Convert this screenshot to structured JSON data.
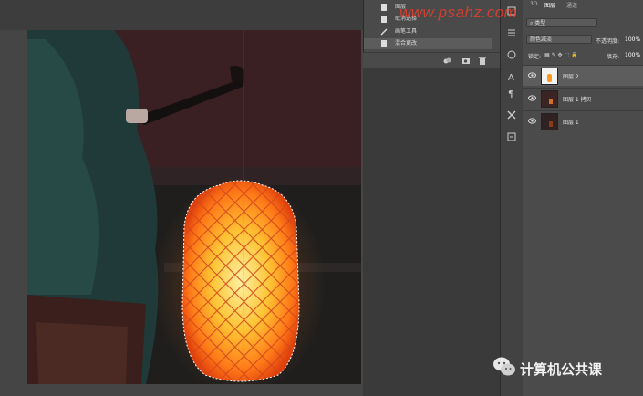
{
  "watermark": "www.psahz.com",
  "history": {
    "items": [
      {
        "label": "图层"
      },
      {
        "label": "取消选择"
      },
      {
        "label": "画笔工具"
      },
      {
        "label": "混合更改"
      }
    ]
  },
  "layers_panel": {
    "tabs": [
      "3D",
      "图层",
      "通道"
    ],
    "search_placeholder": "类型",
    "blend_mode": "颜色减淡",
    "opacity_label": "不透明度:",
    "opacity_value": "100%",
    "lock_label": "锁定:",
    "fill_label": "填充:",
    "fill_value": "100%",
    "layers": [
      {
        "name": "图层 2",
        "visible": true,
        "active": true
      },
      {
        "name": "图层 1 拷贝",
        "visible": true,
        "active": false
      },
      {
        "name": "图层 1",
        "visible": true,
        "active": false
      }
    ]
  },
  "footer": {
    "brand": "计算机公共课"
  },
  "colors": {
    "lantern_core": "#ffd24a",
    "lantern_edge": "#ff6a1a",
    "watermark": "#ff3c28"
  }
}
